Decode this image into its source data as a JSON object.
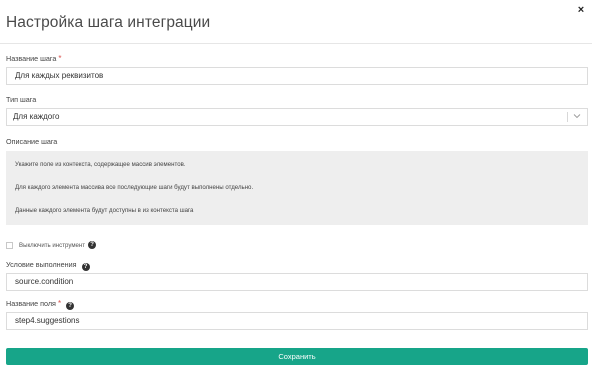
{
  "modal": {
    "title": "Настройка шага интеграции",
    "close_label": "×"
  },
  "step_name": {
    "label": "Название шага",
    "required_mark": "*",
    "value": "Для каждых реквизитов"
  },
  "step_type": {
    "label": "Тип шага",
    "selected": "Для каждого"
  },
  "description": {
    "label": "Описание шага",
    "lines": [
      "Укажите поле из контекста, содержащее массив элементов.",
      "Для каждого элемента массива все последующие шаги будут выполнены отдельно.",
      "Данные каждого элемента будут доступны в из контекста шага"
    ]
  },
  "disable_tool": {
    "label": "Выключить инструмент",
    "checked": false
  },
  "condition": {
    "label": "Условие выполнения",
    "value": "source.condition"
  },
  "field_name": {
    "label": "Название поля",
    "required_mark": "*",
    "value": "step4.suggestions"
  },
  "save_button": {
    "label": "Сохранить",
    "color": "#17a589"
  },
  "icons": {
    "close": "close-icon",
    "help": "help-icon",
    "dropdown": "chevron-down-icon"
  }
}
